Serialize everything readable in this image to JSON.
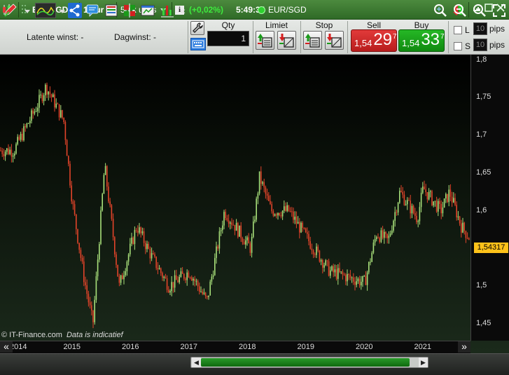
{
  "toolbar": {
    "symbol": "EURSGD",
    "timeframe": "1 uur",
    "units": "50 k units",
    "info_label": "i",
    "change": "(+0,02%)",
    "time": "5:49:34",
    "instrument": "EUR/SGD"
  },
  "orderbar": {
    "latent_label": "Latente winst:",
    "latent_value": "-",
    "day_label": "Dagwinst:",
    "day_value": "-",
    "qty_label": "Qty",
    "qty_value": "1",
    "limit_label": "Limiet",
    "stop_label": "Stop",
    "sell_label": "Sell",
    "buy_label": "Buy",
    "sell_price": {
      "small": "1,54",
      "big": "29",
      "sup": "7"
    },
    "buy_price": {
      "small": "1,54",
      "big": "33",
      "sup": "7"
    },
    "check1_label": "L",
    "check2_label": "S",
    "pips1_value": "10",
    "pips2_value": "10",
    "pips_label": "pips"
  },
  "chart": {
    "copyright": "© IT-Finance.com",
    "disclaimer": "Data is indicatief",
    "current_price": "1,54317"
  },
  "chart_data": {
    "type": "candlestick",
    "x_ticks": [
      "2014",
      "2015",
      "2016",
      "2017",
      "2018",
      "2019",
      "2020",
      "2021"
    ],
    "y_ticks": [
      "1,8",
      "1,75",
      "1,7",
      "1,65",
      "1,6",
      "1,55",
      "1,5",
      "1,45"
    ],
    "ylim": [
      1.428,
      1.807
    ],
    "key_points": [
      {
        "t": 0.0,
        "v": 1.68
      },
      {
        "t": 0.4,
        "v": 1.74
      },
      {
        "t": 0.55,
        "v": 1.765
      },
      {
        "t": 0.85,
        "v": 1.72
      },
      {
        "t": 1.0,
        "v": 1.61
      },
      {
        "t": 1.2,
        "v": 1.51
      },
      {
        "t": 1.35,
        "v": 1.45
      },
      {
        "t": 1.55,
        "v": 1.66
      },
      {
        "t": 1.8,
        "v": 1.5
      },
      {
        "t": 2.1,
        "v": 1.58
      },
      {
        "t": 2.35,
        "v": 1.54
      },
      {
        "t": 2.65,
        "v": 1.5
      },
      {
        "t": 3.0,
        "v": 1.52
      },
      {
        "t": 3.3,
        "v": 1.48
      },
      {
        "t": 3.6,
        "v": 1.6
      },
      {
        "t": 4.05,
        "v": 1.55
      },
      {
        "t": 4.2,
        "v": 1.645
      },
      {
        "t": 4.4,
        "v": 1.6
      },
      {
        "t": 4.7,
        "v": 1.6
      },
      {
        "t": 5.0,
        "v": 1.565
      },
      {
        "t": 5.4,
        "v": 1.52
      },
      {
        "t": 6.0,
        "v": 1.505
      },
      {
        "t": 6.2,
        "v": 1.57
      },
      {
        "t": 6.4,
        "v": 1.56
      },
      {
        "t": 6.6,
        "v": 1.625
      },
      {
        "t": 6.9,
        "v": 1.59
      },
      {
        "t": 7.0,
        "v": 1.63
      },
      {
        "t": 7.3,
        "v": 1.6
      },
      {
        "t": 7.45,
        "v": 1.625
      },
      {
        "t": 7.65,
        "v": 1.58
      },
      {
        "t": 7.9,
        "v": 1.552
      }
    ],
    "candle_up_color": "#a8e07a",
    "candle_down_color": "#e2442a"
  },
  "colors": {
    "title_bar": "#3d7a32",
    "sell_button": "#d42828",
    "buy_button": "#17a317",
    "price_tag": "#ffc21a"
  },
  "bottombar": {
    "icons": [
      "pencil-icon",
      "dropdown-arrow-icon",
      "indicators-icon",
      "dropdown-arrow-icon",
      "share-icon",
      "chat-icon",
      "list-icon",
      "tiles-icon",
      "window-icon",
      "chart-add-icon",
      "scroll-left-icon",
      "zoom-fit-icon",
      "zoom-out-icon",
      "zoom-in-icon",
      "fullscreen-icon"
    ]
  }
}
